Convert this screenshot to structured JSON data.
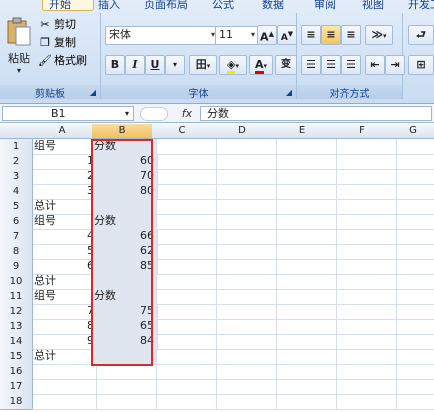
{
  "ribbon": {
    "tabs": [
      "开始",
      "插入",
      "页面布局",
      "公式",
      "数据",
      "审阅",
      "视图",
      "开发工具"
    ],
    "clipboard": {
      "paste": "粘贴",
      "cut": "剪切",
      "copy": "复制",
      "format_painter": "格式刷",
      "label": "剪贴板"
    },
    "font": {
      "font_name": "宋体",
      "font_size": "11",
      "grow": "A",
      "shrink": "A",
      "bold": "B",
      "italic": "I",
      "underline": "U",
      "color_letter": "A",
      "phonetic": "变",
      "label": "字体"
    },
    "alignment": {
      "label": "对齐方式"
    }
  },
  "formula_bar": {
    "name_box": "B1",
    "fx": "fx",
    "value": "分数"
  },
  "columns": [
    "A",
    "B",
    "C",
    "D",
    "E",
    "F",
    "G"
  ],
  "rows": [
    {
      "n": "1",
      "a": "组号",
      "b": "分数"
    },
    {
      "n": "2",
      "a": "1",
      "b": "60"
    },
    {
      "n": "3",
      "a": "2",
      "b": "70"
    },
    {
      "n": "4",
      "a": "3",
      "b": "80"
    },
    {
      "n": "5",
      "a": "总计",
      "b": ""
    },
    {
      "n": "6",
      "a": "组号",
      "b": "分数"
    },
    {
      "n": "7",
      "a": "4",
      "b": "66"
    },
    {
      "n": "8",
      "a": "5",
      "b": "62"
    },
    {
      "n": "9",
      "a": "6",
      "b": "85"
    },
    {
      "n": "10",
      "a": "总计",
      "b": ""
    },
    {
      "n": "11",
      "a": "组号",
      "b": "分数"
    },
    {
      "n": "12",
      "a": "7",
      "b": "75"
    },
    {
      "n": "13",
      "a": "8",
      "b": "65"
    },
    {
      "n": "14",
      "a": "9",
      "b": "84"
    },
    {
      "n": "15",
      "a": "总计",
      "b": ""
    },
    {
      "n": "16",
      "a": "",
      "b": ""
    },
    {
      "n": "17",
      "a": "",
      "b": ""
    },
    {
      "n": "18",
      "a": "",
      "b": ""
    }
  ],
  "colors": {
    "highlight_border": "#d62b2b",
    "selected_column": "#dfe6f0"
  }
}
